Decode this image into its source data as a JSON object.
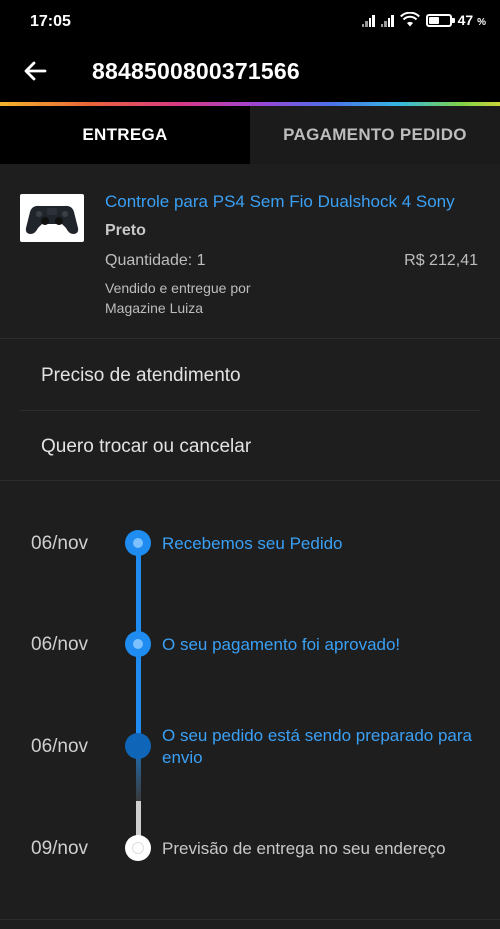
{
  "status_bar": {
    "time": "17:05",
    "battery": "47",
    "battery_unit": "%",
    "battery_level": 0.47
  },
  "header": {
    "title": "8848500800371566",
    "back_icon": "arrow-left-icon"
  },
  "tabs": [
    {
      "label": "ENTREGA",
      "active": true
    },
    {
      "label": "PAGAMENTO PEDIDO",
      "active": false
    }
  ],
  "product": {
    "name": "Controle para PS4 Sem Fio Dualshock 4 Sony",
    "color": "Preto",
    "quantity": "Quantidade: 1",
    "price": "R$ 212,41",
    "sold_by_label": "Vendido e entregue por",
    "seller": "Magazine Luiza"
  },
  "actions": [
    {
      "label": "Preciso de atendimento"
    },
    {
      "label": "Quero trocar ou cancelar"
    }
  ],
  "timeline": [
    {
      "date": "06/nov",
      "text": "Recebemos seu Pedido",
      "state": "done"
    },
    {
      "date": "06/nov",
      "text": "O seu pagamento foi aprovado!",
      "state": "done"
    },
    {
      "date": "06/nov",
      "text": "O seu pedido está sendo preparado para envio",
      "state": "current"
    },
    {
      "date": "09/nov",
      "text": "Previsão de entrega no seu endereço",
      "state": "future"
    }
  ],
  "colors": {
    "accent": "#1e8cf0",
    "link": "#3aa0f5",
    "background": "#1e1e1e"
  }
}
